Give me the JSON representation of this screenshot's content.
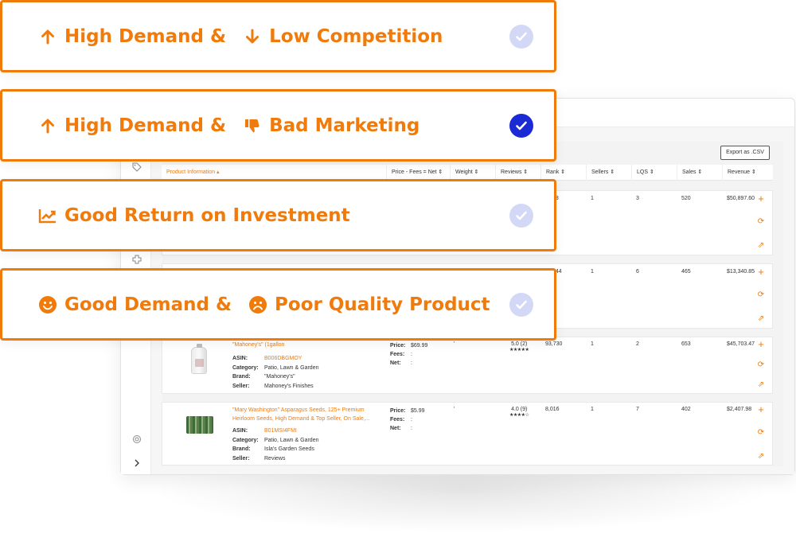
{
  "cards": [
    {
      "text1": "High Demand &",
      "text2": "Low Competition",
      "icon1": "arrow-up-icon",
      "icon2": "arrow-down-icon",
      "checked": false
    },
    {
      "text1": "High Demand &",
      "text2": "Bad Marketing",
      "icon1": "arrow-up-icon",
      "icon2": "thumbs-down-icon",
      "checked": true
    },
    {
      "text1": "Good Return on Investment",
      "icon1": "chart-line-icon",
      "checked": false
    },
    {
      "text1": "Good Demand &",
      "text2": "Poor Quality Product",
      "icon1": "smile-icon",
      "icon2": "frown-icon",
      "checked": false
    }
  ],
  "colors": {
    "accent": "#f07b0b",
    "check_on": "#1a2bd6",
    "check_off": "#d4d8f7"
  },
  "table": {
    "export_label": "Export as .CSV",
    "headers": [
      "Product Information ▴",
      "Price - Fees = Net ⇕",
      "Weight ⇕",
      "Reviews ⇕",
      "Rank ⇕",
      "Sellers ⇕",
      "LQS ⇕",
      "Sales ⇕",
      "Revenue ⇕"
    ],
    "rows": [
      {
        "rank": "88",
        "sellers": "1",
        "lqs": "3",
        "sales": "520",
        "revenue": "$50,897.60"
      },
      {
        "rank": "844",
        "sellers": "1",
        "lqs": "6",
        "sales": "465",
        "revenue": "$13,340.85"
      },
      {
        "title": "\"Mahoney's\" (1gallon",
        "asin_label": "ASIN:",
        "asin": "B006DBGMOY",
        "category_label": "Category:",
        "category": "Patio, Lawn & Garden",
        "brand_label": "Brand:",
        "brand": "\"Mahoney's\"",
        "seller_label": "Seller:",
        "seller": "Mahoney's Finishes",
        "price_label": "Price:",
        "price": "$69.99",
        "fees_label": "Fees:",
        "fees": ":",
        "net_label": "Net:",
        "net": ":",
        "weight": "'",
        "reviews": "5.0 (2)",
        "stars": "★★★★★",
        "rank": "93,730",
        "sellers": "1",
        "lqs": "2",
        "sales": "653",
        "revenue": "$45,703.47"
      },
      {
        "title_line1": "\"Mary Washington\" Asparagus Seeds, 125+ Premium",
        "title_line2": "Heirloom Seeds, High Demand & Top Seller, On Sale,...",
        "asin_label": "ASIN:",
        "asin": "B01MSI4FMI",
        "category_label": "Category:",
        "category": "Patio, Lawn & Garden",
        "brand_label": "Brand:",
        "brand": "Isla's Garden Seeds",
        "seller_label": "Seller:",
        "seller": "Reviews",
        "price_label": "Price:",
        "price": "$5.99",
        "fees_label": "Fees:",
        "fees": ":",
        "net_label": "Net:",
        "net": ":",
        "weight": "'",
        "reviews": "4.0 (9)",
        "stars": "★★★★☆",
        "rank": "8,016",
        "sellers": "1",
        "lqs": "7",
        "sales": "402",
        "revenue": "$2,407.98"
      }
    ]
  }
}
